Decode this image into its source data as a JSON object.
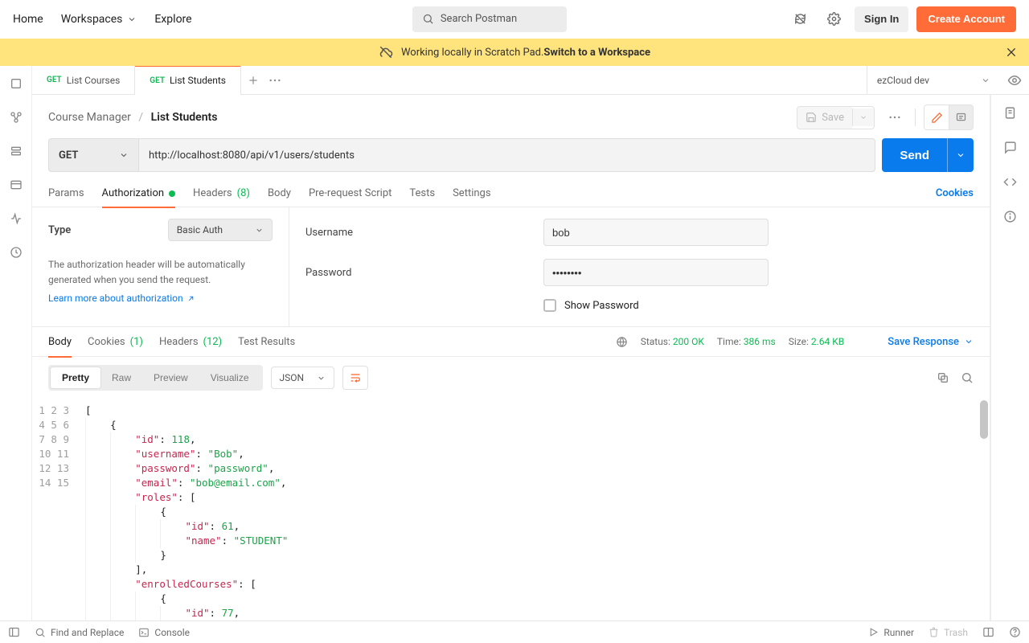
{
  "nav": {
    "home": "Home",
    "workspaces": "Workspaces",
    "explore": "Explore"
  },
  "search": {
    "placeholder": "Search Postman"
  },
  "account": {
    "signin": "Sign In",
    "create": "Create Account"
  },
  "banner": {
    "prefix": "Working locally in Scratch Pad. ",
    "action": "Switch to a Workspace"
  },
  "tabs": [
    {
      "method": "GET",
      "name": "List Courses"
    },
    {
      "method": "GET",
      "name": "List Students"
    }
  ],
  "env": {
    "name": "ezCloud dev"
  },
  "breadcrumb": {
    "collection": "Course Manager",
    "request": "List Students"
  },
  "save_label": "Save",
  "request": {
    "method": "GET",
    "url": "http://localhost:8080/api/v1/users/students",
    "send": "Send"
  },
  "req_tabs": {
    "params": "Params",
    "auth": "Authorization",
    "headers": "Headers",
    "headers_count": "(8)",
    "body": "Body",
    "prereq": "Pre-request Script",
    "tests": "Tests",
    "settings": "Settings",
    "cookies": "Cookies"
  },
  "auth": {
    "type_label": "Type",
    "type_value": "Basic Auth",
    "desc": "The authorization header will be automatically generated when you send the request.",
    "learn": "Learn more about authorization",
    "username_label": "Username",
    "username_value": "bob",
    "password_label": "Password",
    "password_value": "••••••••",
    "show_password": "Show Password"
  },
  "resp_tabs": {
    "body": "Body",
    "cookies": "Cookies",
    "cookies_n": "(1)",
    "headers": "Headers",
    "headers_n": "(12)",
    "test_results": "Test Results"
  },
  "status": {
    "label": "Status:",
    "value": "200 OK",
    "time_label": "Time:",
    "time_value": "386 ms",
    "size_label": "Size:",
    "size_value": "2.64 KB",
    "save_response": "Save Response"
  },
  "body_views": {
    "pretty": "Pretty",
    "raw": "Raw",
    "preview": "Preview",
    "visualize": "Visualize",
    "format": "JSON"
  },
  "response_json_lines": [
    [
      {
        "t": "punc",
        "v": "["
      }
    ],
    [
      {
        "indent": 1
      },
      {
        "t": "punc",
        "v": "{"
      }
    ],
    [
      {
        "indent": 2
      },
      {
        "t": "key",
        "v": "\"id\""
      },
      {
        "t": "punc",
        "v": ": "
      },
      {
        "t": "num",
        "v": "118"
      },
      {
        "t": "punc",
        "v": ","
      }
    ],
    [
      {
        "indent": 2
      },
      {
        "t": "key",
        "v": "\"username\""
      },
      {
        "t": "punc",
        "v": ": "
      },
      {
        "t": "str",
        "v": "\"Bob\""
      },
      {
        "t": "punc",
        "v": ","
      }
    ],
    [
      {
        "indent": 2
      },
      {
        "t": "key",
        "v": "\"password\""
      },
      {
        "t": "punc",
        "v": ": "
      },
      {
        "t": "str",
        "v": "\"password\""
      },
      {
        "t": "punc",
        "v": ","
      }
    ],
    [
      {
        "indent": 2
      },
      {
        "t": "key",
        "v": "\"email\""
      },
      {
        "t": "punc",
        "v": ": "
      },
      {
        "t": "str",
        "v": "\"bob@email.com\""
      },
      {
        "t": "punc",
        "v": ","
      }
    ],
    [
      {
        "indent": 2
      },
      {
        "t": "key",
        "v": "\"roles\""
      },
      {
        "t": "punc",
        "v": ": ["
      }
    ],
    [
      {
        "indent": 3
      },
      {
        "t": "punc",
        "v": "{"
      }
    ],
    [
      {
        "indent": 4
      },
      {
        "t": "key",
        "v": "\"id\""
      },
      {
        "t": "punc",
        "v": ": "
      },
      {
        "t": "num",
        "v": "61"
      },
      {
        "t": "punc",
        "v": ","
      }
    ],
    [
      {
        "indent": 4
      },
      {
        "t": "key",
        "v": "\"name\""
      },
      {
        "t": "punc",
        "v": ": "
      },
      {
        "t": "str",
        "v": "\"STUDENT\""
      }
    ],
    [
      {
        "indent": 3
      },
      {
        "t": "punc",
        "v": "}"
      }
    ],
    [
      {
        "indent": 2
      },
      {
        "t": "punc",
        "v": "],"
      }
    ],
    [
      {
        "indent": 2
      },
      {
        "t": "key",
        "v": "\"enrolledCourses\""
      },
      {
        "t": "punc",
        "v": ": ["
      }
    ],
    [
      {
        "indent": 3
      },
      {
        "t": "punc",
        "v": "{"
      }
    ],
    [
      {
        "indent": 4
      },
      {
        "t": "key",
        "v": "\"id\""
      },
      {
        "t": "punc",
        "v": ": "
      },
      {
        "t": "num",
        "v": "77"
      },
      {
        "t": "punc",
        "v": ","
      }
    ]
  ],
  "statusbar": {
    "find": "Find and Replace",
    "console": "Console",
    "runner": "Runner",
    "trash": "Trash"
  }
}
